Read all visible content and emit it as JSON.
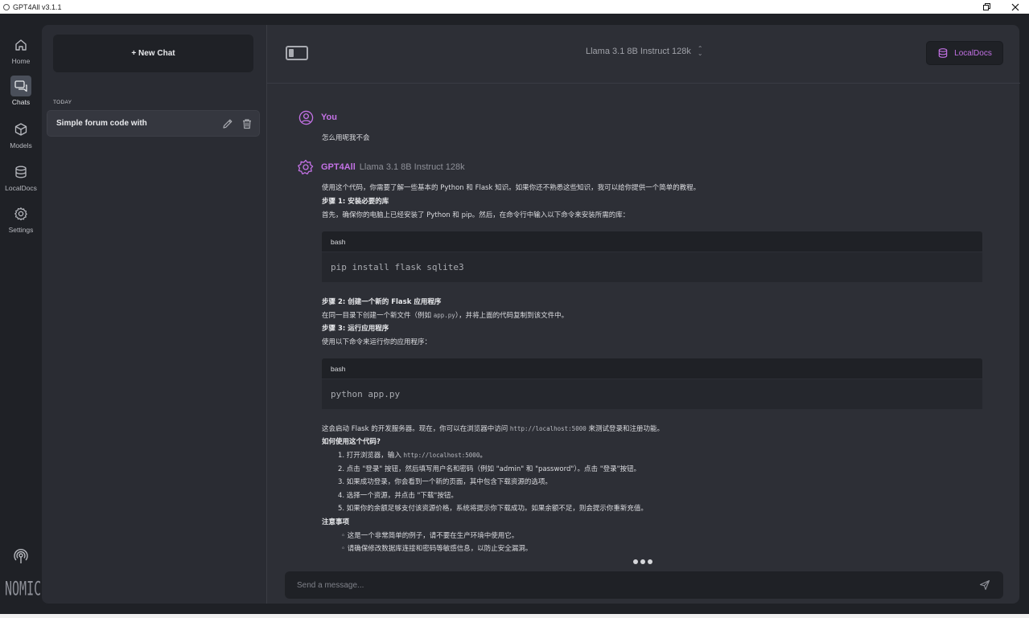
{
  "window": {
    "title": "GPT4All v3.1.1"
  },
  "nav": {
    "items": [
      {
        "label": "Home",
        "icon": "home-icon"
      },
      {
        "label": "Chats",
        "icon": "chats-icon"
      },
      {
        "label": "Models",
        "icon": "models-icon"
      },
      {
        "label": "LocalDocs",
        "icon": "localdocs-icon"
      },
      {
        "label": "Settings",
        "icon": "settings-icon"
      }
    ],
    "active": "Chats",
    "logo": "NOMIC"
  },
  "sidepanel": {
    "new_chat_label": "+ New Chat",
    "section_label": "TODAY",
    "chats": [
      {
        "title": "Simple forum code with"
      }
    ]
  },
  "header": {
    "model": "Llama 3.1 8B Instruct 128k",
    "localdocs_label": "LocalDocs"
  },
  "messages": {
    "user": {
      "name": "You",
      "text": "怎么用呢我不会"
    },
    "assistant": {
      "name": "GPT4All",
      "model": "Llama 3.1 8B Instruct 128k",
      "lines": {
        "l1": "使用这个代码，你需要了解一些基本的 Python 和 Flask 知识。如果你还不熟悉这些知识，我可以给你提供一个简单的教程。",
        "l2": "步骤 1: 安装必要的库",
        "l3": "首先，确保你的电脑上已经安装了 Python 和 pip。然后，在命令行中输入以下命令来安装所需的库：",
        "code1_lang": "bash",
        "code1": "pip install flask sqlite3",
        "l4": "步骤 2: 创建一个新的 Flask 应用程序",
        "l5a": "在同一目录下创建一个新文件（例如 ",
        "l5code": "app.py",
        "l5b": "），并将上面的代码复制到该文件中。",
        "l6": "步骤 3: 运行应用程序",
        "l7": "使用以下命令来运行你的应用程序：",
        "code2_lang": "bash",
        "code2": "python app.py",
        "l8a": "这会启动 Flask 的开发服务器。现在，你可以在浏览器中访问 ",
        "l8code": "http://localhost:5000",
        "l8b": " 来测试登录和注册功能。",
        "l9": "如何使用这个代码?",
        "s1a": "1. 打开浏览器，输入 ",
        "s1code": "http://localhost:5000",
        "s1b": "。",
        "s2": "2. 点击 \"登录\" 按钮，然后填写用户名和密码（例如 \"admin\" 和 \"password\"）。点击 \"登录\"按钮。",
        "s3": "3. 如果成功登录，你会看到一个新的页面，其中包含下载资源的选项。",
        "s4": "4. 选择一个资源，并点击 \"下载\"按钮。",
        "s5": "5. 如果你的余额足够支付该资源价格，系统将提示你下载成功。如果余额不足，则会提示你重新充值。",
        "l10": "注意事项",
        "b1": "◦ 这是一个非常简单的例子，请不要在生产环境中使用它。",
        "b2": "◦ 请确保修改数据库连接和密码等敏感信息，以防止安全漏洞。"
      }
    }
  },
  "input": {
    "placeholder": "Send a message..."
  },
  "colors": {
    "accent": "#c472e6",
    "background": "#1f2126",
    "panel": "#2a2c33",
    "main": "#2d2f36"
  }
}
